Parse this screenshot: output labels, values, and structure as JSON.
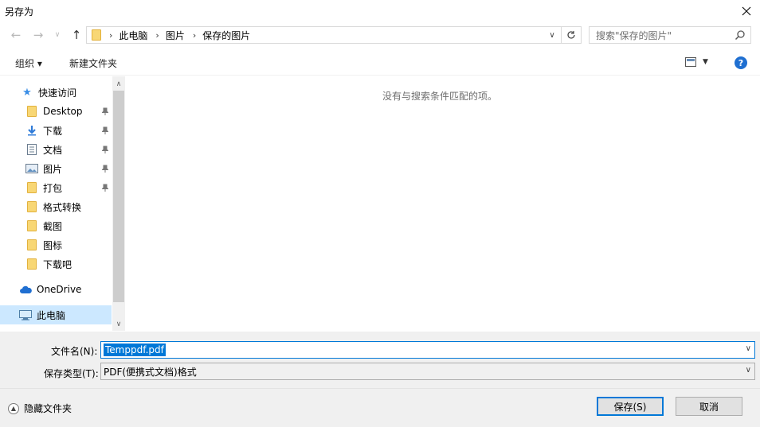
{
  "window": {
    "title": "另存为"
  },
  "nav": {
    "breadcrumbs": [
      "此电脑",
      "图片",
      "保存的图片"
    ],
    "search_placeholder": "搜索\"保存的图片\""
  },
  "toolbar": {
    "organize_label": "组织 ▾",
    "new_folder_label": "新建文件夹"
  },
  "sidebar": {
    "quick_access": "快速访问",
    "items": [
      {
        "label": "Desktop",
        "icon": "folder-icon",
        "pinned": true
      },
      {
        "label": "下载",
        "icon": "download-arrow-icon",
        "pinned": true
      },
      {
        "label": "文档",
        "icon": "document-icon",
        "pinned": true
      },
      {
        "label": "图片",
        "icon": "pictures-icon",
        "pinned": true
      },
      {
        "label": "打包",
        "icon": "folder-icon",
        "pinned": true
      },
      {
        "label": "格式转换",
        "icon": "folder-icon",
        "pinned": false
      },
      {
        "label": "截图",
        "icon": "folder-icon",
        "pinned": false
      },
      {
        "label": "图标",
        "icon": "folder-icon",
        "pinned": false
      },
      {
        "label": "下载吧",
        "icon": "folder-icon",
        "pinned": false
      }
    ],
    "onedrive": "OneDrive",
    "this_pc": "此电脑"
  },
  "main": {
    "empty_message": "没有与搜索条件匹配的项。"
  },
  "form": {
    "filename_label": "文件名(N):",
    "filename_value": "Temppdf.pdf",
    "filetype_label": "保存类型(T):",
    "filetype_value": "PDF(便携式文档)格式"
  },
  "footer": {
    "hide_folders_label": "隐藏文件夹",
    "save_label": "保存(S)",
    "cancel_label": "取消"
  },
  "colors": {
    "accent": "#0078d7",
    "selection": "#cce8ff",
    "panel": "#f0f0f0"
  }
}
